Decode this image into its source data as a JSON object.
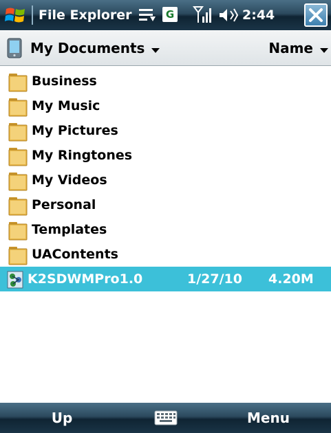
{
  "titlebar": {
    "title": "File Explorer",
    "time": "2:44",
    "network_badge": "G",
    "icons": [
      "windows-start-icon",
      "connectivity-icon",
      "network-g-icon",
      "signal-strength-icon",
      "volume-icon",
      "close-icon"
    ]
  },
  "header": {
    "current_folder": "My Documents",
    "sort_by": "Name"
  },
  "folders": [
    {
      "label": "Business"
    },
    {
      "label": "My Music"
    },
    {
      "label": "My Pictures"
    },
    {
      "label": "My Ringtones"
    },
    {
      "label": "My Videos"
    },
    {
      "label": "Personal"
    },
    {
      "label": "Templates"
    },
    {
      "label": "UAContents"
    }
  ],
  "files": [
    {
      "name": "K2SDWMPro1.0",
      "date": "1/27/10",
      "size": "4.20M",
      "selected": true
    }
  ],
  "softkeys": {
    "left": "Up",
    "right": "Menu"
  },
  "colors": {
    "selection": "#3cc0d9",
    "folder": "#e8b84a",
    "bar": "#1a3446"
  }
}
